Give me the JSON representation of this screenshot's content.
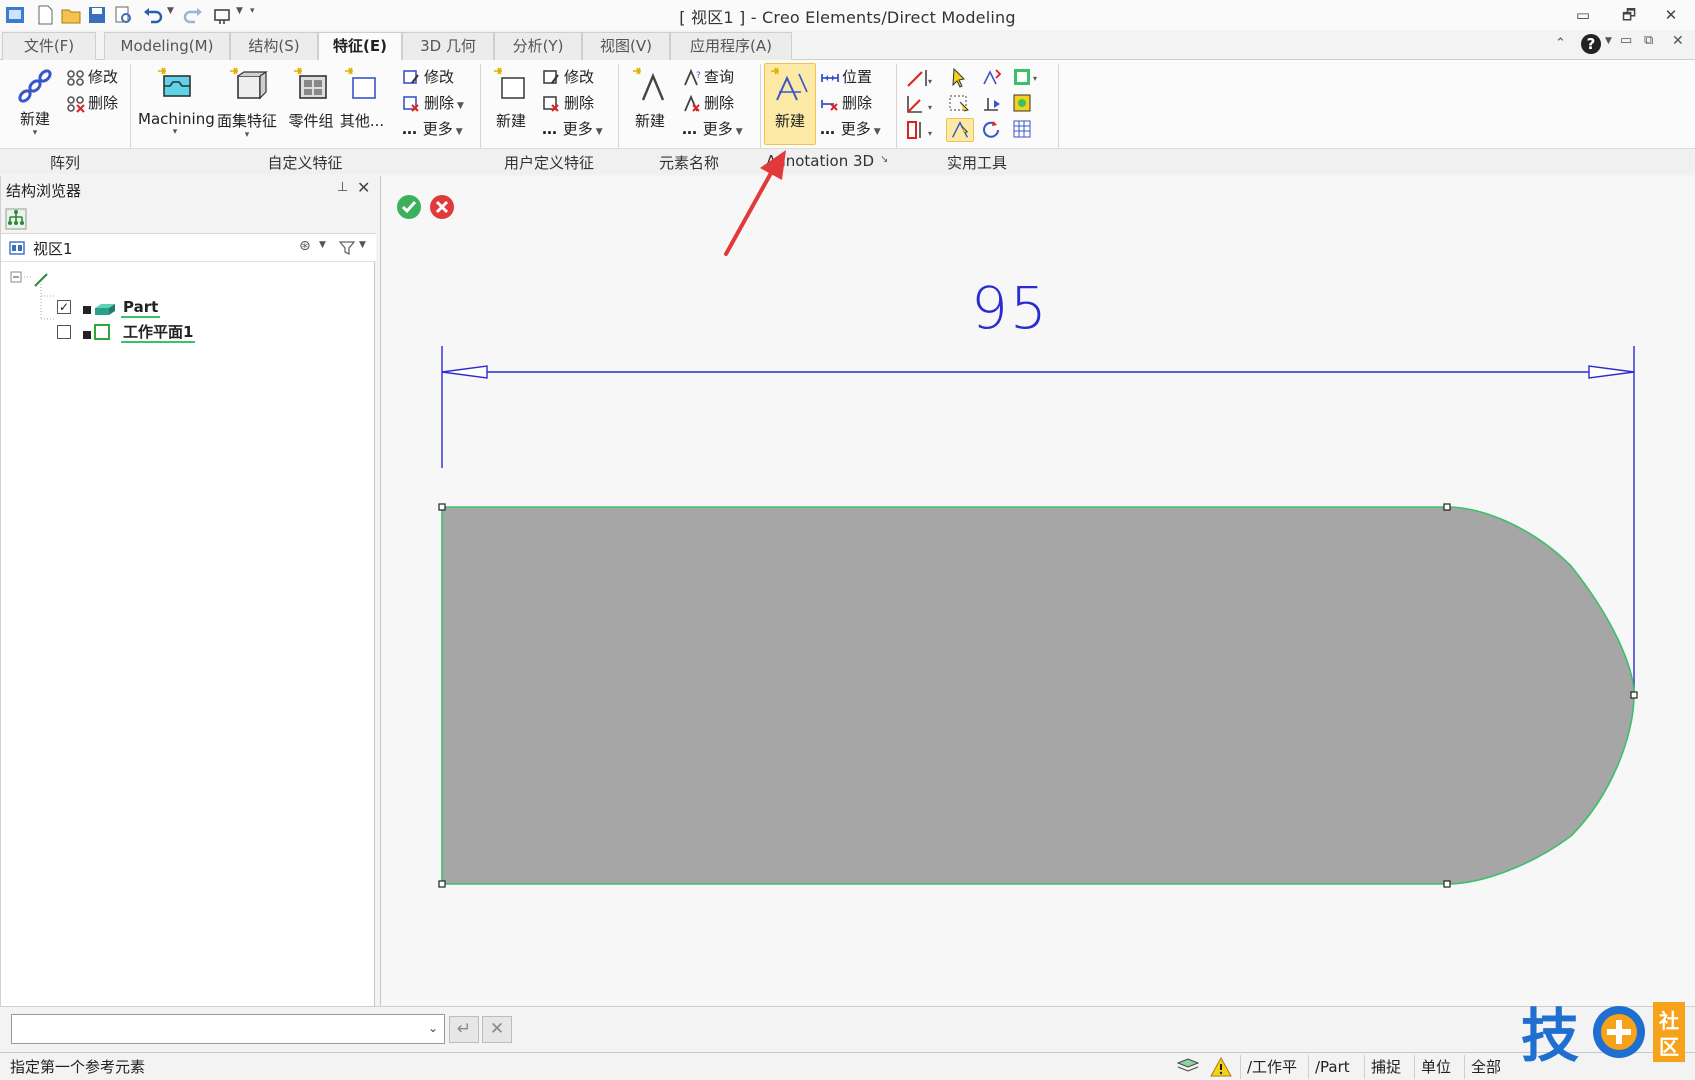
{
  "app": {
    "title": "[ 视区1 ] - Creo Elements/Direct Modeling"
  },
  "window_controls": {
    "minimize": "▭",
    "restore": "🗗",
    "close": "✕"
  },
  "menu_tabs": [
    {
      "label": "文件(F)"
    },
    {
      "label": "Modeling(M)"
    },
    {
      "label": "结构(S)"
    },
    {
      "label": "特征(E)",
      "active": true
    },
    {
      "label": "3D 几何"
    },
    {
      "label": "分析(Y)"
    },
    {
      "label": "视图(V)"
    },
    {
      "label": "应用程序(A)"
    }
  ],
  "ribbon": {
    "pattern": {
      "new": "新建",
      "modify": "修改",
      "delete": "删除",
      "group": "阵列"
    },
    "custom_features": {
      "machining": "Machining",
      "face_set": "面集特征",
      "part_group": "零件组",
      "other": "其他...",
      "modify": "修改",
      "delete": "删除",
      "more": "更多",
      "group": "自定义特征"
    },
    "user_defined": {
      "new": "新建",
      "modify": "修改",
      "delete": "删除",
      "more": "更多",
      "group": "用户定义特征"
    },
    "element_name": {
      "new": "新建",
      "query": "查询",
      "delete": "删除",
      "more": "更多",
      "group": "元素名称"
    },
    "annotation3d": {
      "new": "新建",
      "position": "位置",
      "delete": "删除",
      "more": "更多",
      "group": "Annotation 3D"
    },
    "utilities": {
      "group": "实用工具"
    }
  },
  "left_panel": {
    "title": "结构浏览器",
    "view": "视区1",
    "tree": [
      {
        "label": "Part",
        "checked": true
      },
      {
        "label": "工作平面1",
        "checked": false
      }
    ]
  },
  "viewport": {
    "dimension_value": "95",
    "accent_green": "#3cc06a",
    "dimension_color": "#2b2bd0",
    "profile_fill": "#a6a6a6"
  },
  "statusbar": {
    "message": "指定第一个参考元素",
    "workplane": "/工作平",
    "part": "/Part",
    "snap": "捕捉",
    "units": "单位",
    "filter": "全部"
  },
  "logo": {
    "text": "技术社区"
  }
}
